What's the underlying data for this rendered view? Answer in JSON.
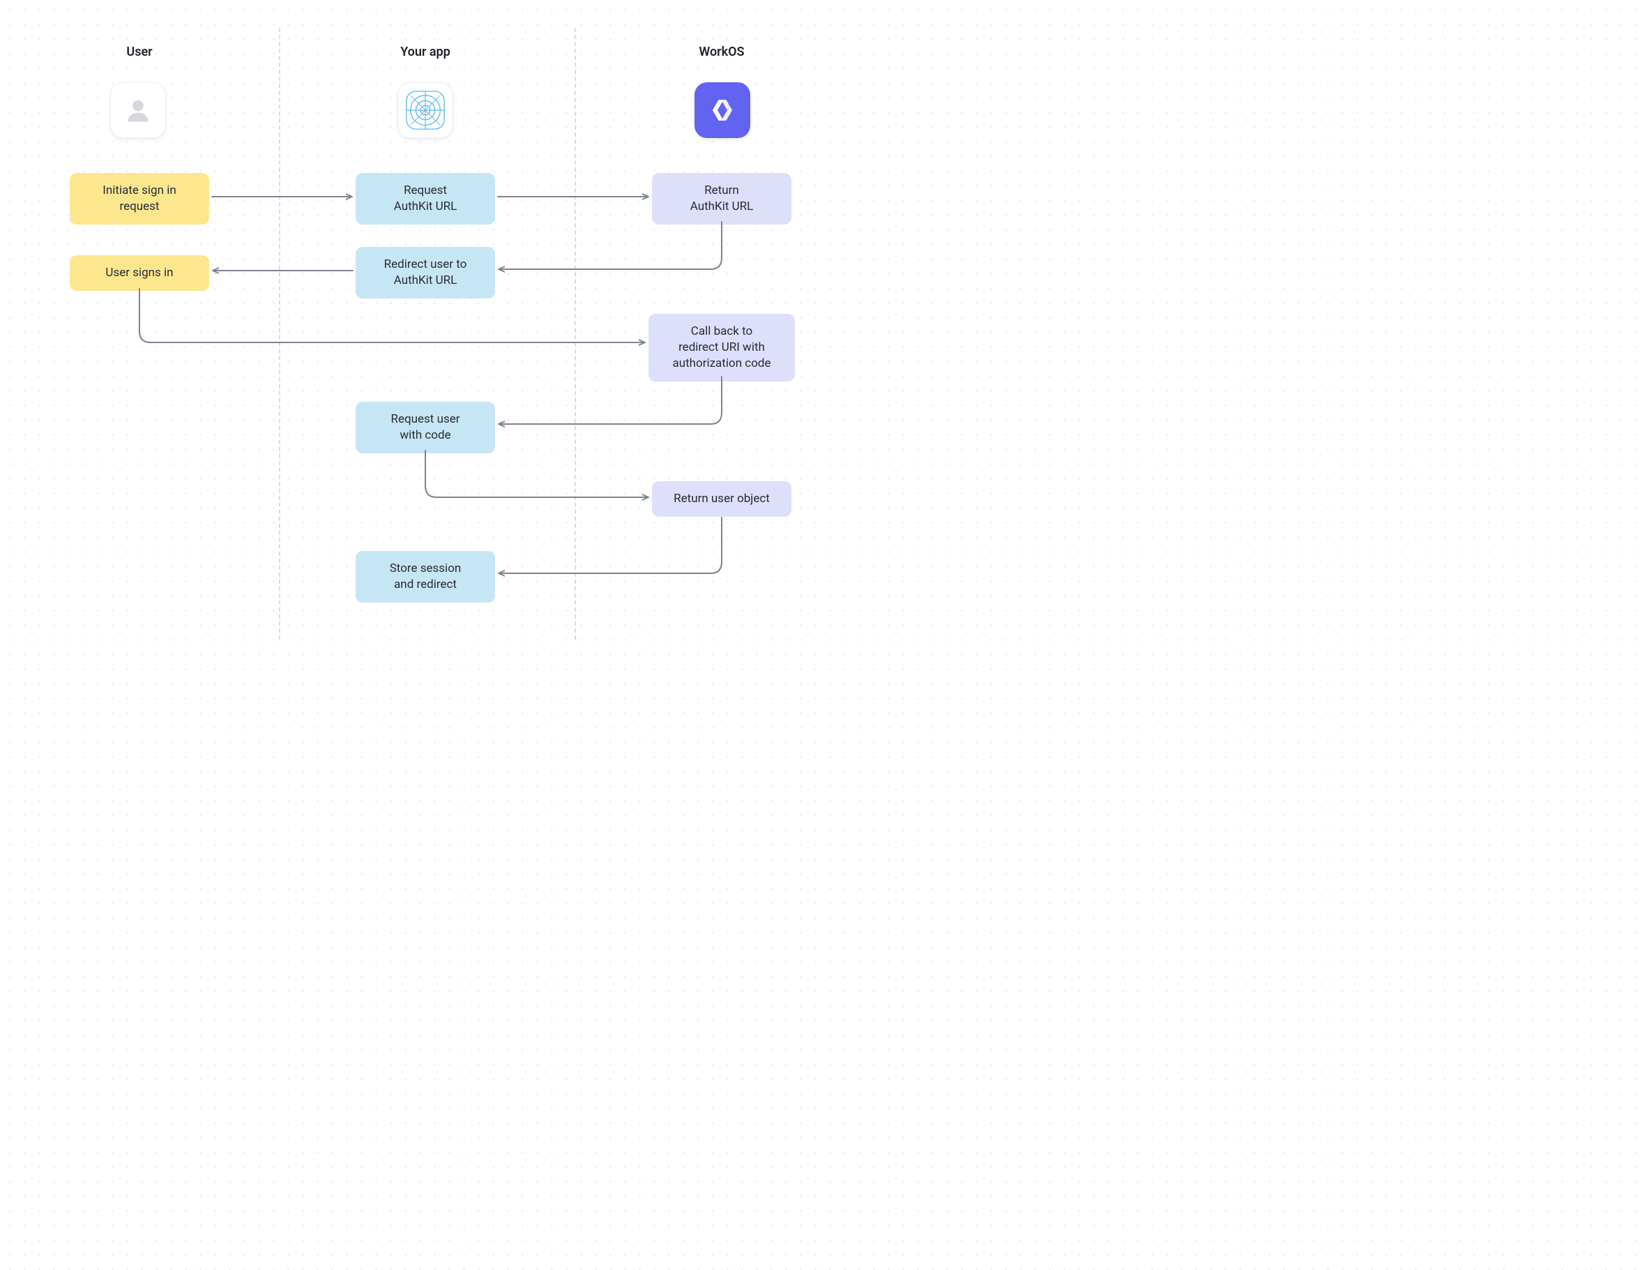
{
  "columns": {
    "user": {
      "title": "User"
    },
    "app": {
      "title": "Your app"
    },
    "workos": {
      "title": "WorkOS"
    }
  },
  "iconNames": {
    "user": "user-icon",
    "app": "app-blueprint-icon",
    "workos": "workos-logo-icon"
  },
  "boxes": {
    "initiate": "Initiate sign in\nrequest",
    "requestAuth": "Request\nAuthKit URL",
    "returnAuth": "Return\nAuthKit URL",
    "redirectUser": "Redirect user to\nAuthKit URL",
    "signsIn": "User signs in",
    "callback": "Call back to\nredirect URI with\nauthorization code",
    "requestUser": "Request user\nwith code",
    "returnObj": "Return user object",
    "storeSession": "Store session\nand redirect"
  },
  "colors": {
    "yellow": "#fce78f",
    "blue": "#c7e6f5",
    "purple": "#dedffb",
    "workos": "#6363f1",
    "arrow": "#7e8290"
  }
}
